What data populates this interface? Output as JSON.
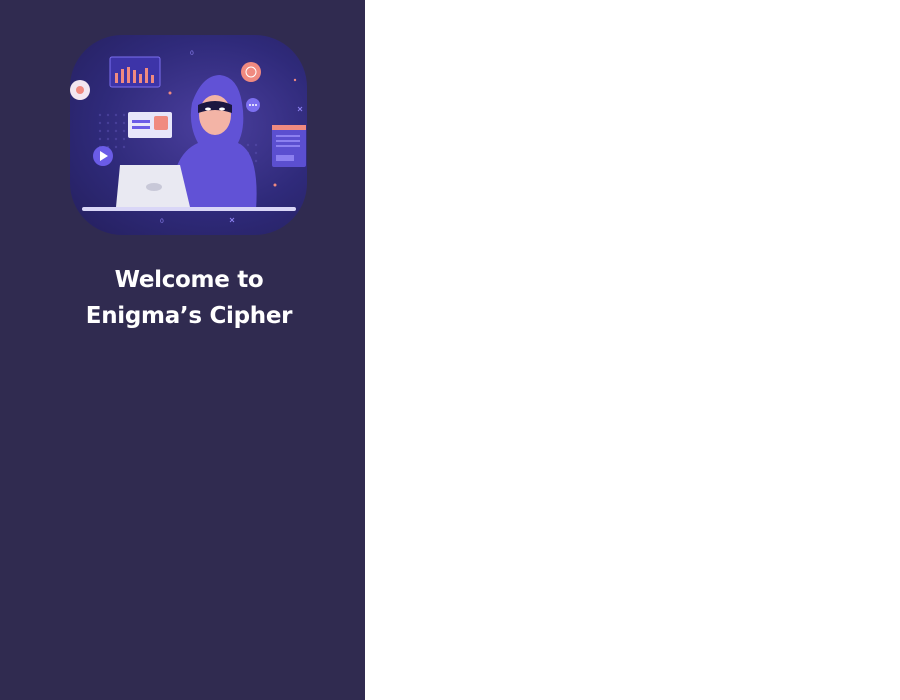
{
  "sidebar": {
    "hero_image": "hacker-illustration",
    "welcome_line1": "Welcome to",
    "welcome_line2": "Enigma’s Cipher"
  },
  "colors": {
    "sidebar_bg": "#302b50",
    "main_bg": "#ffffff",
    "accent_purple": "#6b5ce7",
    "accent_coral": "#f5877a"
  }
}
